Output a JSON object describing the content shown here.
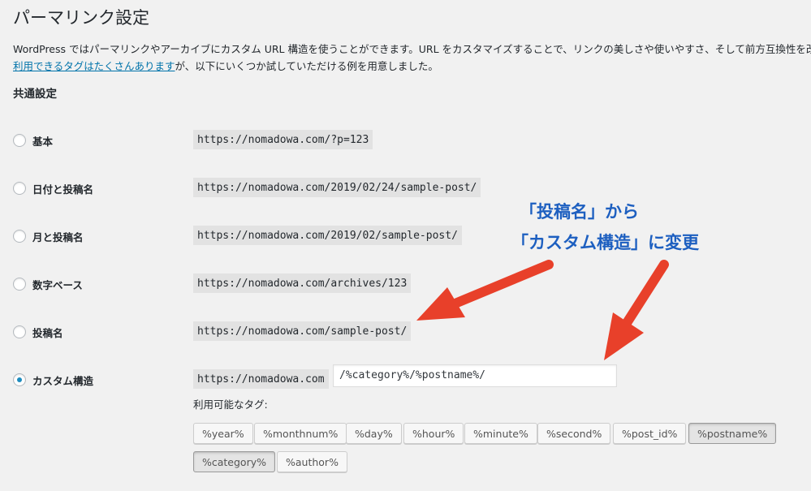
{
  "page": {
    "title": "パーマリンク設定",
    "intro_line1": "WordPress ではパーマリンクやアーカイブにカスタム URL 構造を使うことができます。URL をカスタマイズすることで、リンクの美しさや使いやすさ、そして前方互換性を改善で",
    "intro_link": "利用できるタグはたくさんあります",
    "intro_line2_rest": "が、以下にいくつか試していただける例を用意しました。"
  },
  "section": {
    "title": "共通設定"
  },
  "options": [
    {
      "label": "基本",
      "url": "https://nomadowa.com/?p=123",
      "checked": false
    },
    {
      "label": "日付と投稿名",
      "url": "https://nomadowa.com/2019/02/24/sample-post/",
      "checked": false
    },
    {
      "label": "月と投稿名",
      "url": "https://nomadowa.com/2019/02/sample-post/",
      "checked": false
    },
    {
      "label": "数字ベース",
      "url": "https://nomadowa.com/archives/123",
      "checked": false
    },
    {
      "label": "投稿名",
      "url": "https://nomadowa.com/sample-post/",
      "checked": false
    },
    {
      "label": "カスタム構造",
      "url": "https://nomadowa.com",
      "checked": true
    }
  ],
  "custom_structure": {
    "value": "/%category%/%postname%/"
  },
  "available_tags": {
    "label": "利用可能なタグ:",
    "tags": [
      "%year%",
      "%monthnum%",
      "%day%",
      "%hour%",
      "%minute%",
      "%second%",
      "%post_id%",
      "%postname%",
      "%category%",
      "%author%"
    ],
    "active": [
      "%postname%",
      "%category%"
    ]
  },
  "annotation": {
    "line1": "「投稿名」から",
    "line2": "「カスタム構造」に変更",
    "color": "#1d5fc0",
    "arrow_color": "#e8402a"
  }
}
